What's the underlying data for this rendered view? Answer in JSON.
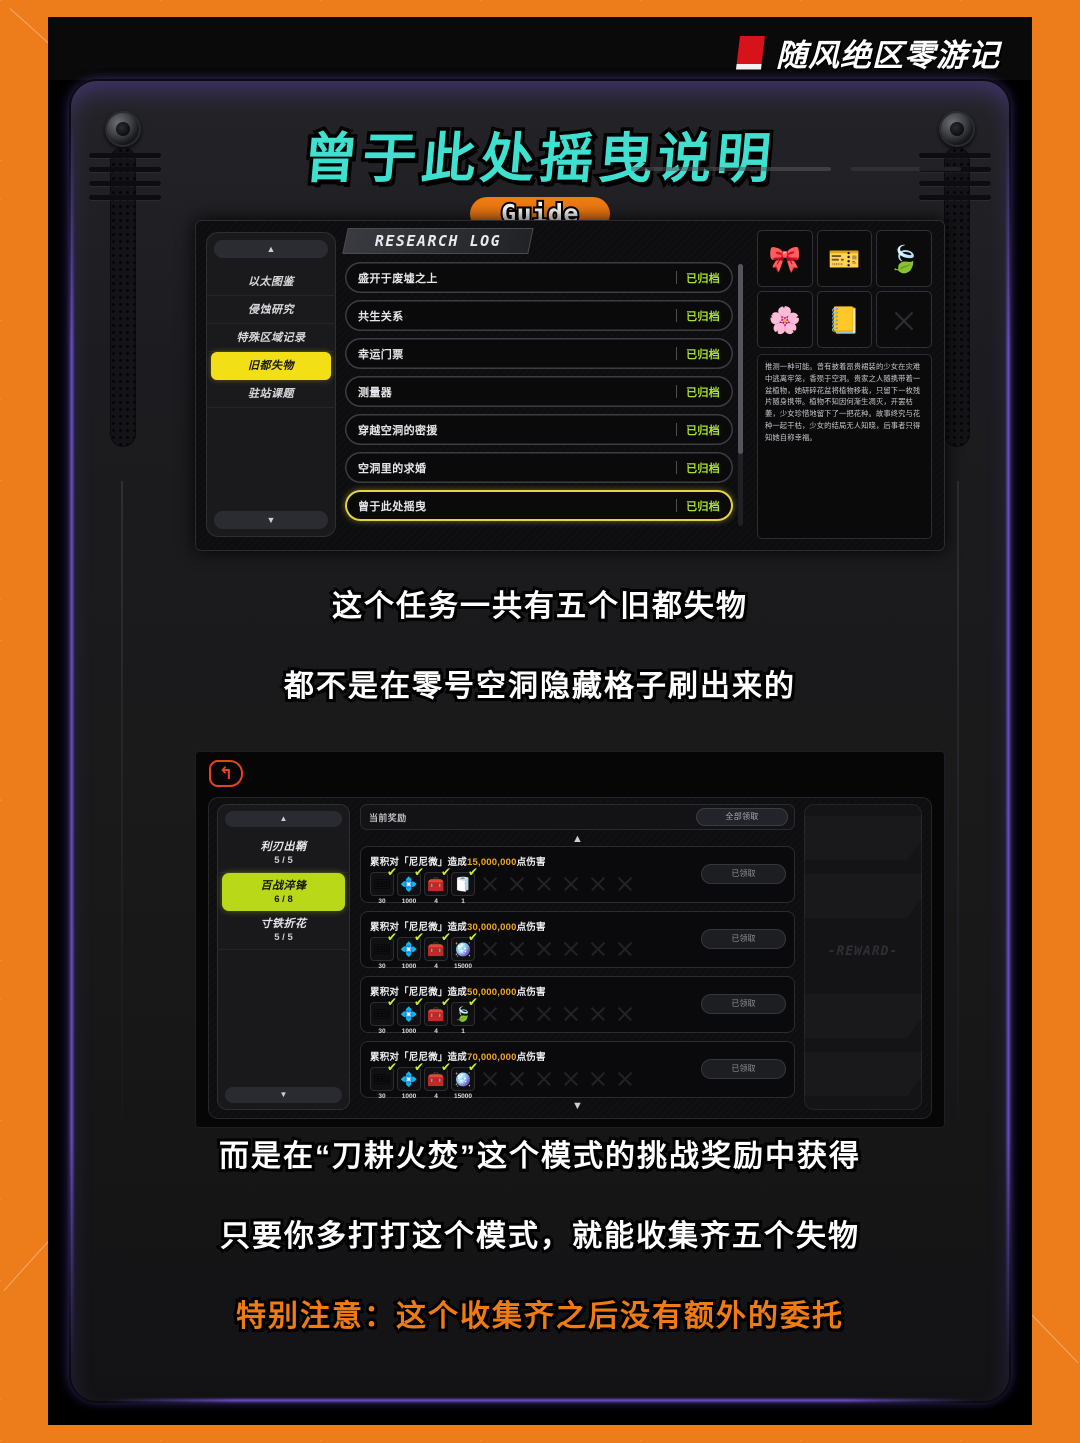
{
  "channel": {
    "name": "随风绝区零游记"
  },
  "header": {
    "title": "曾于此处摇曳说明",
    "badge": "Guide"
  },
  "research_screen": {
    "panel_title": "RESEARCH LOG",
    "scroll_up": "▲",
    "scroll_down": "▼",
    "sidebar": [
      {
        "label": "以太图鉴",
        "active": false
      },
      {
        "label": "侵蚀研究",
        "active": false
      },
      {
        "label": "特殊区域记录",
        "active": false
      },
      {
        "label": "旧都失物",
        "active": true
      },
      {
        "label": "驻站课题",
        "active": false
      }
    ],
    "entries": [
      {
        "name": "盛开于废墟之上",
        "status": "已归档",
        "selected": false
      },
      {
        "name": "共生关系",
        "status": "已归档",
        "selected": false
      },
      {
        "name": "幸运门票",
        "status": "已归档",
        "selected": false
      },
      {
        "name": "测量器",
        "status": "已归档",
        "selected": false
      },
      {
        "name": "穿越空洞的密援",
        "status": "已归档",
        "selected": false
      },
      {
        "name": "空洞里的求婚",
        "status": "已归档",
        "selected": false
      },
      {
        "name": "曾于此处摇曳",
        "status": "已归档",
        "selected": true
      }
    ],
    "item_slots": [
      {
        "icon": "🎀",
        "empty": false
      },
      {
        "icon": "🎫",
        "empty": false
      },
      {
        "icon": "🍃",
        "empty": false
      },
      {
        "icon": "🌸",
        "empty": false
      },
      {
        "icon": "📒",
        "empty": false
      },
      {
        "icon": "",
        "empty": true
      }
    ],
    "description": "推测一种可能。曾有披着昂贵裙装的少女在灾难中逃离牢笼，香殒于空洞。贵家之人随携带着一盆植物，她研碎花盆将植物移栽，只留下一枚残片随身携带。植物不知因何渐生凋灭，开罢枯萎，少女珍惜地留下了一把花种。故事终究与花种一起干枯，少女的结局无人知晓，后事者只得知她自称幸福。"
  },
  "caption_middle": {
    "line1": "这个任务一共有五个旧都失物",
    "line2": "都不是在零号空洞隐藏格子刷出来的"
  },
  "reward_screen": {
    "back_icon": "↰",
    "current_label": "当前奖励",
    "claim_all": "全部领取",
    "scroll_up": "▲",
    "scroll_down": "▼",
    "modes": [
      {
        "name": "利刃出鞘",
        "progress": "5 / 5",
        "active": false
      },
      {
        "name": "百战淬锋",
        "progress": "6 / 8",
        "active": true
      },
      {
        "name": "寸铁折花",
        "progress": "5 / 5",
        "active": false
      }
    ],
    "watermark": "-REWARD-",
    "rewards": [
      {
        "prefix": "累积对「尼尼微」造成",
        "amount": "15,000,000",
        "suffix": "点伤害",
        "claim_label": "已领取",
        "items": [
          {
            "icon": "🎟",
            "qty": "30"
          },
          {
            "icon": "💠",
            "qty": "1000"
          },
          {
            "icon": "🧰",
            "qty": "4"
          },
          {
            "icon": "🧻",
            "qty": "1"
          }
        ]
      },
      {
        "prefix": "累积对「尼尼微」造成",
        "amount": "30,000,000",
        "suffix": "点伤害",
        "claim_label": "已领取",
        "items": [
          {
            "icon": "🎟",
            "qty": "30"
          },
          {
            "icon": "💠",
            "qty": "1000"
          },
          {
            "icon": "🧰",
            "qty": "4"
          },
          {
            "icon": "🪩",
            "qty": "15000"
          }
        ]
      },
      {
        "prefix": "累积对「尼尼微」造成",
        "amount": "50,000,000",
        "suffix": "点伤害",
        "claim_label": "已领取",
        "items": [
          {
            "icon": "🎟",
            "qty": "30"
          },
          {
            "icon": "💠",
            "qty": "1000"
          },
          {
            "icon": "🧰",
            "qty": "4"
          },
          {
            "icon": "🍃",
            "qty": "1"
          }
        ]
      },
      {
        "prefix": "累积对「尼尼微」造成",
        "amount": "70,000,000",
        "suffix": "点伤害",
        "claim_label": "已领取",
        "items": [
          {
            "icon": "🎟",
            "qty": "30"
          },
          {
            "icon": "💠",
            "qty": "1000"
          },
          {
            "icon": "🧰",
            "qty": "4"
          },
          {
            "icon": "🪩",
            "qty": "15000"
          }
        ]
      }
    ]
  },
  "caption_bottom": {
    "line1": "而是在“刀耕火焚”这个模式的挑战奖励中获得",
    "line2": "只要你多打打这个模式，就能收集齐五个失物",
    "line3": "特别注意：这个收集齐之后没有额外的委托"
  }
}
